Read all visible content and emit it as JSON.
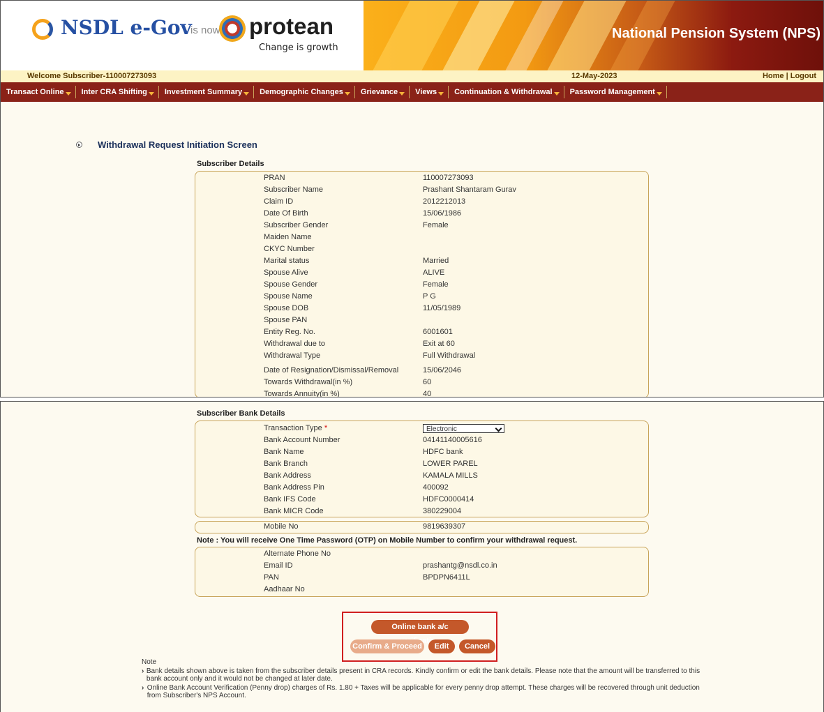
{
  "header": {
    "brand": "NSDL e-Gov",
    "is_now": "is now",
    "protean": "protean",
    "tagline": "Change is growth",
    "system_title": "National Pension System (NPS)"
  },
  "welcome": {
    "text": "Welcome Subscriber-110007273093",
    "date": "12-May-2023",
    "home": "Home",
    "separator": " | ",
    "logout": "Logout"
  },
  "menu": [
    "Transact Online",
    "Inter CRA Shifting",
    "Investment Summary",
    "Demographic Changes",
    "Grievance",
    "Views",
    "Continuation & Withdrawal",
    "Password Management"
  ],
  "page_heading": "Withdrawal Request Initiation Screen",
  "subscriber": {
    "title": "Subscriber Details",
    "rows": [
      {
        "label": "PRAN",
        "value": "110007273093"
      },
      {
        "label": "Subscriber Name",
        "value": "Prashant Shantaram Gurav"
      },
      {
        "label": "Claim ID",
        "value": "2012212013"
      },
      {
        "label": "Date Of Birth",
        "value": "15/06/1986"
      },
      {
        "label": "Subscriber Gender",
        "value": "Female"
      },
      {
        "label": "Maiden Name",
        "value": ""
      },
      {
        "label": "CKYC Number",
        "value": ""
      },
      {
        "label": "Marital status",
        "value": "Married"
      },
      {
        "label": "Spouse Alive",
        "value": "ALIVE"
      },
      {
        "label": "Spouse Gender",
        "value": "Female"
      },
      {
        "label": "Spouse Name",
        "value": "P G"
      },
      {
        "label": "Spouse DOB",
        "value": "11/05/1989"
      },
      {
        "label": "Spouse PAN",
        "value": ""
      },
      {
        "label": "Entity Reg. No.",
        "value": "6001601"
      },
      {
        "label": "Withdrawal due to",
        "value": "Exit at 60"
      },
      {
        "label": "Withdrawal Type",
        "value": "Full Withdrawal"
      },
      {
        "label": "Date of Resignation/Dismissal/Removal",
        "value": "15/06/2046"
      },
      {
        "label": "Towards Withdrawal(in %)",
        "value": "60"
      },
      {
        "label": "Towards Annuity(in %)",
        "value": "40"
      }
    ]
  },
  "bank": {
    "title": "Subscriber Bank Details",
    "transaction_type_label": "Transaction Type",
    "required_mark": "*",
    "transaction_type_value": "Electronic",
    "rows": [
      {
        "label": "Bank Account Number",
        "value": "04141140005616"
      },
      {
        "label": "Bank Name",
        "value": "HDFC bank"
      },
      {
        "label": "Bank Branch",
        "value": "LOWER PAREL"
      },
      {
        "label": "Bank Address",
        "value": "KAMALA MILLS"
      },
      {
        "label": "Bank Address Pin",
        "value": "400092"
      },
      {
        "label": "Bank IFS Code",
        "value": "HDFC0000414"
      },
      {
        "label": "Bank MICR Code",
        "value": "380229004"
      }
    ],
    "mobile_label": "Mobile No",
    "mobile_value": "9819639307",
    "otp_note": "Note : You will receive One Time Password (OTP) on Mobile Number to confirm your withdrawal request.",
    "contact_rows": [
      {
        "label": "Alternate Phone No",
        "value": ""
      },
      {
        "label": "Email ID",
        "value": "prashantg@nsdl.co.in"
      },
      {
        "label": "PAN",
        "value": "BPDPN6411L"
      },
      {
        "label": "Aadhaar No",
        "value": ""
      }
    ]
  },
  "buttons": {
    "verify": "Online bank a/c verification",
    "confirm": "Confirm & Proceed",
    "edit": "Edit",
    "cancel": "Cancel"
  },
  "notes": {
    "title": "Note",
    "items": [
      "Bank details shown above is taken from the subscriber details present in CRA records. Kindly confirm or edit the bank details. Please note that the amount will be transferred to this bank account only and it would not be changed at later date.",
      "Online Bank Account Verification (Penny drop) charges of Rs. 1.80 + Taxes will be applicable for every penny drop attempt. These charges will be recovered through unit deduction from Subscriber's NPS Account."
    ]
  }
}
